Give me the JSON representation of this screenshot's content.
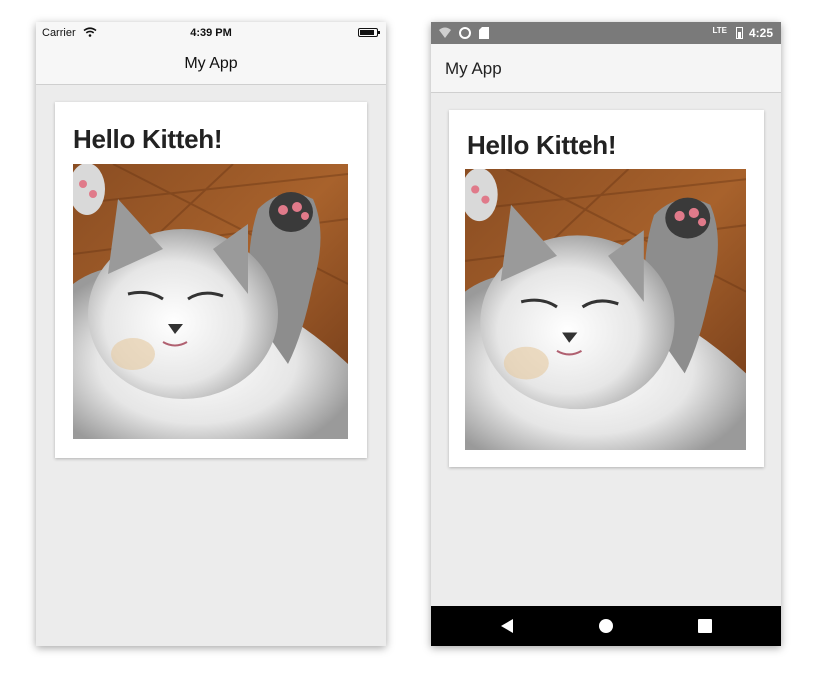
{
  "ios": {
    "carrier": "Carrier",
    "time": "4:39 PM",
    "title": "My App",
    "card_title": "Hello Kitteh!"
  },
  "android": {
    "time": "4:25",
    "network": "LTE",
    "title": "My App",
    "card_title": "Hello Kitteh!",
    "nav_icons": [
      "back-icon",
      "home-icon",
      "recents-icon"
    ]
  },
  "colors": {
    "background": "#ececec",
    "android_statusbar": "#7a7a7a",
    "android_navbar": "#000000"
  }
}
